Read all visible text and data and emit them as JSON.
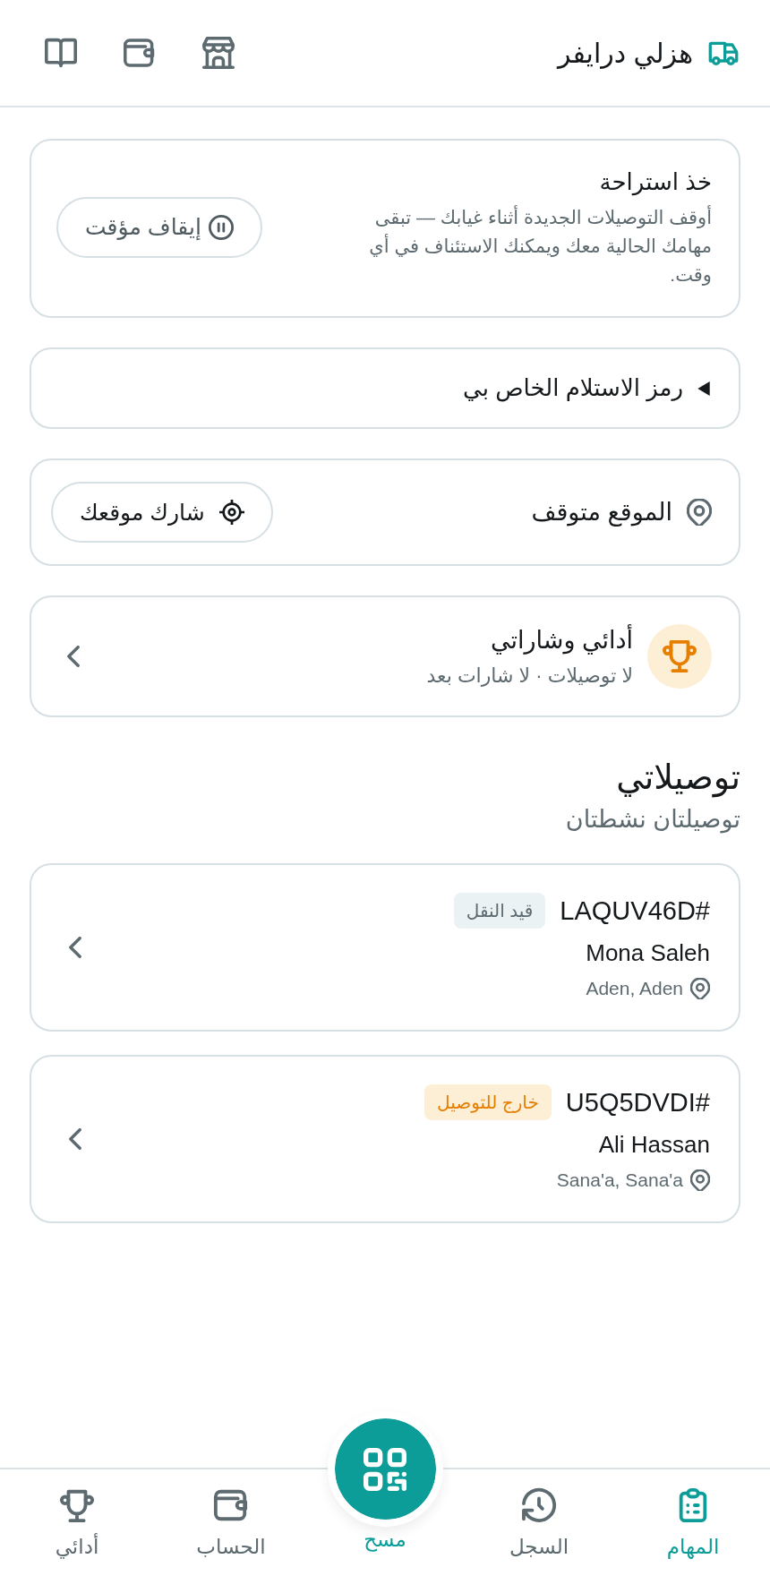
{
  "header": {
    "title": "هزلي درايفر"
  },
  "break_card": {
    "title": "خذ استراحة",
    "description": "أوقف التوصيلات الجديدة أثناء غيابك — تبقى مهامك الحالية معك ويمكنك الاستئناف في أي وقت.",
    "button": "إيقاف مؤقت"
  },
  "pickup_code": {
    "label": "رمز الاستلام الخاص بي",
    "expanded": false
  },
  "location": {
    "status": "الموقع متوقف",
    "button": "شارك موقعك"
  },
  "performance": {
    "title": "أدائي وشاراتي",
    "summary": "لا توصيلات · لا شارات بعد"
  },
  "deliveries": {
    "title": "توصيلاتي",
    "subtitle": "توصيلتان نشطتان",
    "items": [
      {
        "code": "#LAQUV46D",
        "status": {
          "label": "قيد النقل",
          "kind": "transit"
        },
        "customer": "Mona Saleh",
        "address": "Aden, Aden"
      },
      {
        "code": "#U5Q5DVDI",
        "status": {
          "label": "خارج للتوصيل",
          "kind": "outbound"
        },
        "customer": "Ali Hassan",
        "address": "Sana'a, Sana'a"
      }
    ]
  },
  "bottom_nav": {
    "items": [
      {
        "label": "المهام",
        "kind": "tab",
        "selected": true
      },
      {
        "label": "السجل",
        "kind": "tab",
        "selected": false
      },
      {
        "label": "مسح",
        "kind": "scan",
        "selected": false
      },
      {
        "label": "الحساب",
        "kind": "tab",
        "selected": false
      },
      {
        "label": "أدائي",
        "kind": "tab",
        "selected": false
      }
    ]
  }
}
